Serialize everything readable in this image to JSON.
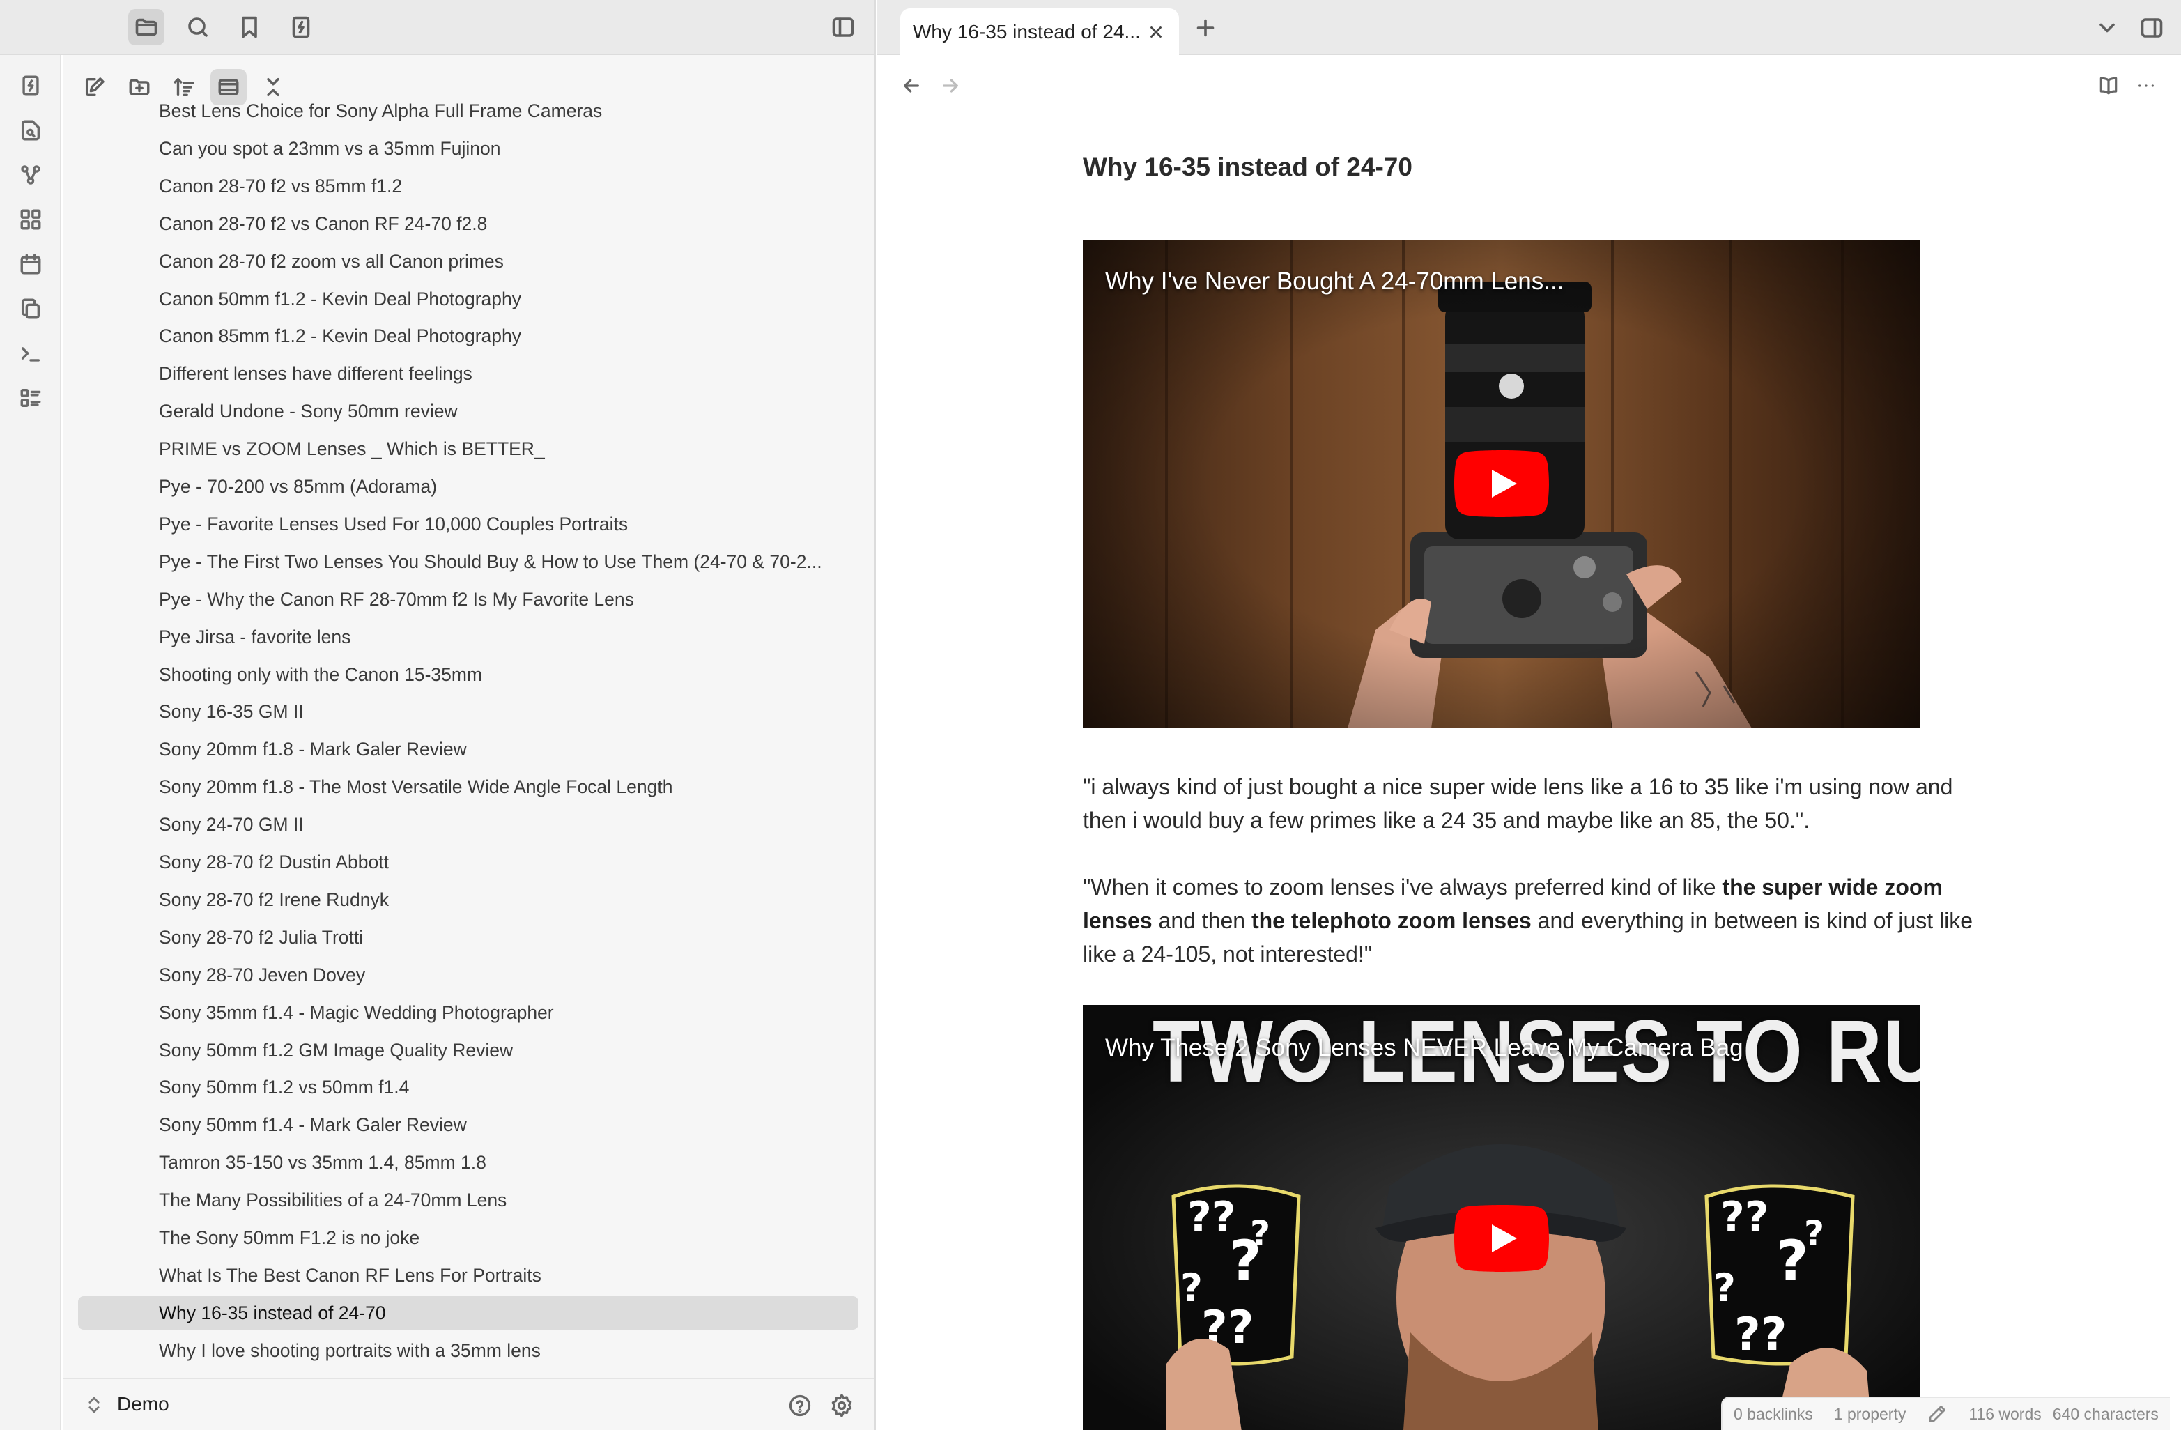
{
  "tab": {
    "title": "Why 16-35 instead of 24...",
    "close_label": "×"
  },
  "files": [
    "Best Lens Choice for Sony Alpha Full Frame Cameras",
    "Can you spot a 23mm vs a 35mm Fujinon",
    "Canon 28-70 f2 vs 85mm f1.2",
    "Canon 28-70 f2 vs Canon RF 24-70 f2.8",
    "Canon 28-70 f2 zoom vs all Canon primes",
    "Canon 50mm f1.2 - Kevin Deal Photography",
    "Canon 85mm f1.2 - Kevin Deal Photography",
    "Different lenses have different feelings",
    "Gerald Undone - Sony 50mm review",
    "PRIME vs ZOOM Lenses _ Which is BETTER_",
    "Pye - 70-200 vs 85mm (Adorama)",
    "Pye - Favorite Lenses Used For 10,000 Couples Portraits",
    "Pye - The First Two Lenses You Should Buy & How to Use Them (24-70 & 70-2...",
    "Pye - Why the Canon RF 28-70mm f2 Is My Favorite Lens",
    "Pye Jirsa - favorite lens",
    "Shooting only with the Canon 15-35mm",
    "Sony 16-35 GM II",
    "Sony 20mm f1.8 - Mark Galer Review",
    "Sony 20mm f1.8 - The Most Versatile Wide Angle Focal Length",
    "Sony 24-70 GM II",
    "Sony 28-70 f2 Dustin Abbott",
    "Sony 28-70 f2 Irene Rudnyk",
    "Sony 28-70 f2 Julia Trotti",
    "Sony 28-70 Jeven Dovey",
    "Sony 35mm f1.4 - Magic Wedding Photographer",
    "Sony 50mm f1.2 GM Image Quality Review",
    "Sony 50mm f1.2 vs 50mm f1.4",
    "Sony 50mm f1.4 - Mark Galer Review",
    "Tamron 35-150 vs 35mm 1.4, 85mm 1.8",
    "The Many Possibilities of a 24-70mm Lens",
    "The Sony 50mm F1.2 is no joke",
    "What Is The Best Canon RF Lens For Portraits",
    "Why 16-35 instead of 24-70",
    "Why I love shooting portraits with a 35mm lens"
  ],
  "active_file_index": 32,
  "vault": {
    "name": "Demo"
  },
  "note": {
    "title": "Why 16-35 instead of 24-70",
    "video1_title": "Why I've Never Bought A 24-70mm Lens...",
    "quote1": "\"i always kind of just bought a nice super wide lens like a 16 to 35 like i'm using now and then i would buy a few primes like a 24 35 and maybe like an 85, the 50.\".",
    "quote2": {
      "p1": "\"When it comes to zoom lenses i've always preferred kind of like ",
      "b1": "the super wide zoom lenses",
      "p2": " and then ",
      "b2": "the telephoto zoom lenses",
      "p3": " and everything in between is kind of just like like a 24-105, not interested!\""
    },
    "video2_title": "Why These 2 Sony Lenses NEVER Leave My Camera Bag",
    "video2_overlay": "TWO LENSES TO RULE THEM ALL"
  },
  "status": {
    "backlinks": "0 backlinks",
    "properties": "1 property",
    "words": "116 words",
    "characters": "640 characters"
  },
  "colors": {
    "accent": "#7f6df2",
    "youtube_red": "#ff0000",
    "active_item": "#dcdcdc"
  }
}
